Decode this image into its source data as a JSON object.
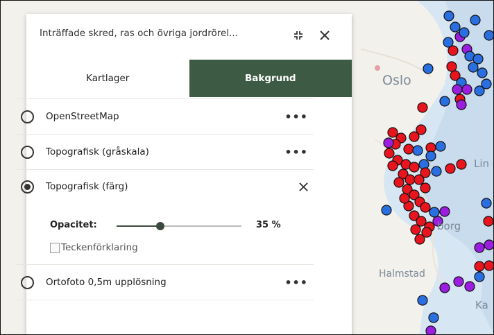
{
  "panel": {
    "title": "Inträffade skred, ras och övriga jordrörel...",
    "collapse_icon": "collapse-arrows-icon",
    "close_icon": "close-icon"
  },
  "tabs": [
    {
      "label": "Kartlager",
      "active": false
    },
    {
      "label": "Bakgrund",
      "active": true
    }
  ],
  "layers": [
    {
      "label": "OpenStreetMap",
      "selected": false,
      "action": "more-options"
    },
    {
      "label": "Topografisk (gråskala)",
      "selected": false,
      "action": "more-options"
    },
    {
      "label": "Topografisk (färg)",
      "selected": true,
      "action": "close",
      "opacity_label": "Opacitet:",
      "opacity_value": 0.35,
      "opacity_text": "35 %",
      "legend_alt": "Teckenförklaring"
    },
    {
      "label": "Ortofoto 0,5m upplösning",
      "selected": false,
      "action": "more-options"
    }
  ],
  "map": {
    "labels": [
      "Oslo",
      "Lin",
      "borg",
      "Halmstad",
      "Ka"
    ],
    "colors": {
      "red": "#e8141e",
      "blue": "#2a6fe0",
      "purple": "#9b1ee0",
      "land": "#f3f1ec",
      "water": "#b8d1ea"
    }
  },
  "accent_color": "#3d5a45"
}
